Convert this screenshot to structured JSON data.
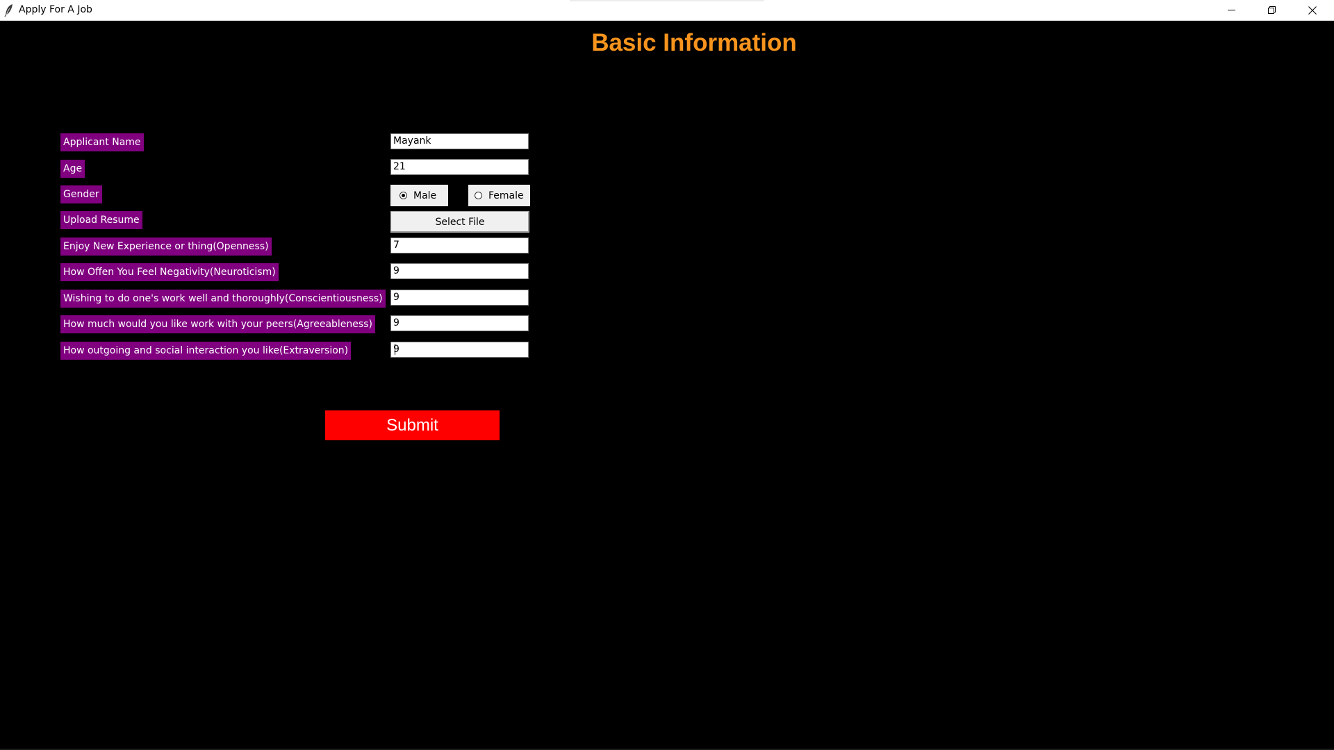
{
  "window": {
    "title": "Apply For A Job",
    "icons": {
      "app": "feather-icon",
      "minimize": "minimize-icon",
      "maximize": "restore-icon",
      "close": "close-icon"
    }
  },
  "form": {
    "heading": "Basic Information",
    "heading_color": "#f7941d",
    "label_bg_color": "#800080",
    "fields": {
      "name": {
        "label": "Applicant Name",
        "value": "Mayank"
      },
      "age": {
        "label": "Age",
        "value": "21"
      },
      "gender": {
        "label": "Gender",
        "options": [
          "Male",
          "Female"
        ],
        "selected": "Male"
      },
      "resume": {
        "label": "Upload Resume",
        "button": "Select File"
      },
      "openness": {
        "label": "Enjoy New Experience or thing(Openness)",
        "value": "7"
      },
      "neuroticism": {
        "label": "How Offen You Feel Negativity(Neuroticism)",
        "value": "9"
      },
      "conscientiousness": {
        "label": "Wishing to do one's work well and thoroughly(Conscientiousness)",
        "value": "9"
      },
      "agreeableness": {
        "label": "How much would you like work with your peers(Agreeableness)",
        "value": "9"
      },
      "extraversion": {
        "label": "How outgoing and social interaction you like(Extraversion)",
        "value": "9"
      }
    },
    "submit": {
      "label": "Submit",
      "color": "#ff0000"
    }
  }
}
